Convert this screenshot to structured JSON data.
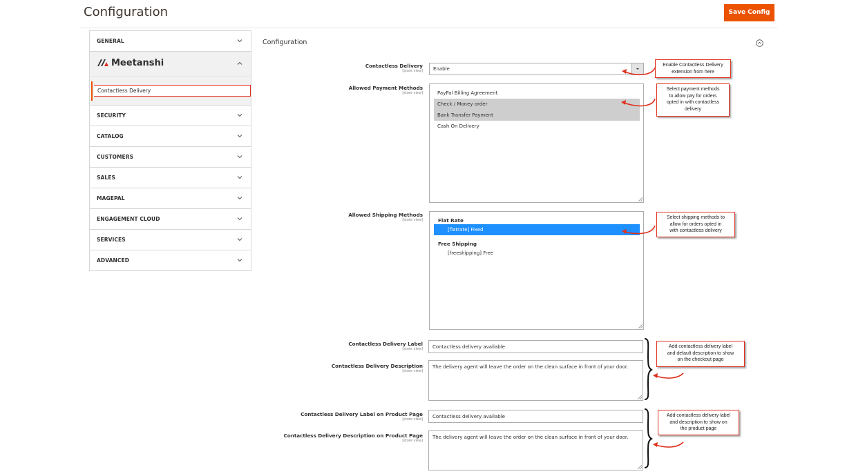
{
  "header": {
    "title": "Configuration",
    "save_label": "Save Config"
  },
  "nav": {
    "general": "GENERAL",
    "brand": "Meetanshi",
    "active_sub": "Contactless Delivery",
    "items": [
      "SECURITY",
      "CATALOG",
      "CUSTOMERS",
      "SALES",
      "MAGEPAL",
      "ENGAGEMENT CLOUD",
      "SERVICES",
      "ADVANCED"
    ]
  },
  "section": {
    "title": "Configuration"
  },
  "scope": "[store view]",
  "fields": {
    "delivery": {
      "label": "Contactless Delivery",
      "value": "Enable"
    },
    "payment": {
      "label": "Allowed Payment Methods",
      "options": [
        "PayPal Billing Agreement",
        "Check / Money order",
        "Bank Transfer Payment",
        "Cash On Delivery"
      ]
    },
    "shipping": {
      "label": "Allowed Shipping Methods",
      "group1": "Flat Rate",
      "opt1": "[flatrate] Fixed",
      "group2": "Free Shipping",
      "opt2": "[freeshipping] Free"
    },
    "label_field": {
      "label": "Contactless Delivery Label",
      "value": "Contactless delivery available"
    },
    "desc_field": {
      "label": "Contactless Delivery Description",
      "value": "The delivery agent will leave the order on the clean surface in front of your door."
    },
    "pp_label": {
      "label": "Contactless Delivery Label on Product Page",
      "value": "Contactless delivery available"
    },
    "pp_desc": {
      "label": "Contactless Delivery Description on Product Page",
      "value": "The delivery agent will leave the order on the clean surface in front of your door."
    }
  },
  "callouts": {
    "c1": [
      "Enable Contactless Delivery",
      "extension from here"
    ],
    "c2": [
      "Select payment methods",
      "to allow pay for orders",
      "opted in with contactless",
      "delivery"
    ],
    "c3": [
      "Select shipping methods to",
      "allow for orders opted in",
      "with contactless delivery"
    ],
    "c4": [
      "Add contactless delivery label",
      "and default description to show",
      "on the checkout page"
    ],
    "c5": [
      "Add contactless delivery label",
      "and description to show on",
      "the product page"
    ]
  },
  "colors": {
    "accent": "#eb5202",
    "callout_border": "#e0301e",
    "selected_blue": "#1e90ff"
  }
}
